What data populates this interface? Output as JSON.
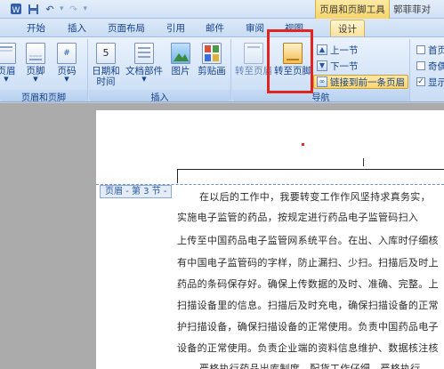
{
  "quick_access": {
    "icons": [
      "word-icon",
      "save-icon",
      "undo-icon",
      "redo-icon",
      "customize-icon"
    ],
    "undo_glyph": "↶",
    "redo_glyph": "↷"
  },
  "contextual_tab_group": "页眉和页脚工具",
  "document_title": "郭菲菲对",
  "tabs": [
    "开始",
    "插入",
    "页面布局",
    "引用",
    "邮件",
    "审阅",
    "视图",
    "设计"
  ],
  "active_tab": "设计",
  "ribbon": {
    "group_header_footer": {
      "label": "页眉和页脚",
      "buttons": [
        "页眉",
        "页脚",
        "页码"
      ]
    },
    "group_insert": {
      "label": "插入",
      "date_time": "日期和\n时间",
      "doc_parts": "文档部件",
      "picture": "图片",
      "clip_art": "剪贴画"
    },
    "group_navigation": {
      "label": "导航",
      "goto_header": "转至页眉",
      "goto_footer": "转至页脚",
      "previous": "上一节",
      "next": "下一节",
      "link_previous": "链接到前一条页眉"
    },
    "group_options": {
      "first_page": "首页",
      "odd_even": "奇偶",
      "show_doc": "显示"
    }
  },
  "header_tag": "页眉 - 第 3 节 -",
  "body_lines": [
    "在以后的工作中，我要转变工作作风坚持求真务实，",
    "实施电子监管的药品，按规定进行药品电子监管码扫入",
    "上传至中国药品电子监管网系统平台。在出、入库时仔细核",
    "有中国电子监管码的字样，防止漏扫、少扫。扫描后及时上",
    "药品的条码保存好。确保上传数据的及时、准确、完整。上",
    "扫描设备里的信息。扫描后及时充电，确保扫描设备的正常",
    "护扫描设备，确保扫描设备的正常使用。负责中国药品电子",
    "设备的正常使用。负责企业端的资料信息维护、数据核注核",
    "严格执行药品出库制度，配货工作仔细，严格执行"
  ]
}
